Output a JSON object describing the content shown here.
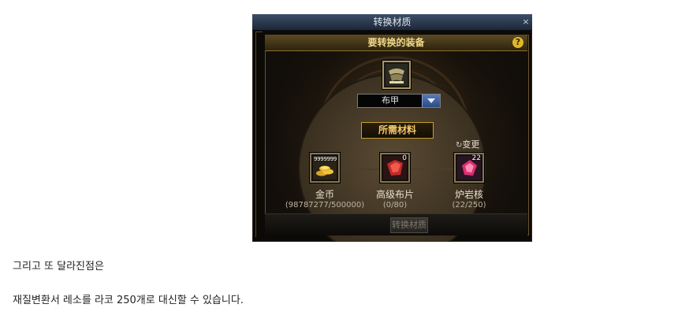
{
  "dialog": {
    "title": "转换材质",
    "close_label": "×",
    "equip_header": "要转换的装备",
    "help_label": "?",
    "selected_type": "布甲",
    "materials_header": "所需材料",
    "change_label": "变更",
    "materials": [
      {
        "name": "金币",
        "qty": "(98787277/500000)",
        "count": "9999999",
        "icon": "gold-coins-icon"
      },
      {
        "name": "高级布片",
        "qty": "(0/80)",
        "count": "0",
        "icon": "red-cloth-icon"
      },
      {
        "name": "炉岩核",
        "qty": "(22/250)",
        "count": "22",
        "icon": "pink-crystal-icon"
      }
    ],
    "convert_button": "转换材质",
    "colors": {
      "gold": "#f1d98a",
      "frame": "#6a5524",
      "title_bar": "#2c3a50"
    }
  },
  "page": {
    "line1": "그리고 또 달라진점은",
    "line2": "재질변환서 레소를 라코 250개로 대신할 수 있습니다."
  }
}
